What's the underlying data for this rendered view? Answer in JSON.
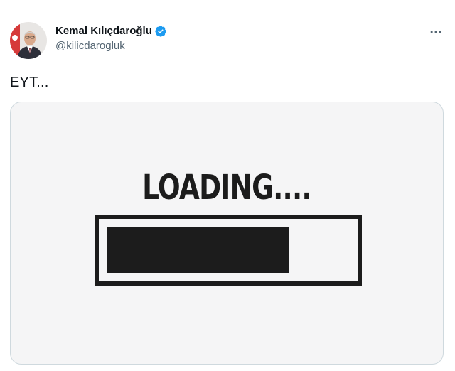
{
  "author": {
    "display_name": "Kemal Kılıçdaroğlu",
    "handle": "@kilicdarogluk",
    "verified": true
  },
  "tweet": {
    "text": "EYT..."
  },
  "media": {
    "image_text": "LOADING....",
    "progress_fraction": 0.75
  },
  "icons": {
    "verified": "verified-badge-icon",
    "more": "more-options-icon"
  },
  "colors": {
    "verified_blue": "#1d9bf0",
    "text_primary": "#0f1419",
    "text_secondary": "#536471"
  }
}
